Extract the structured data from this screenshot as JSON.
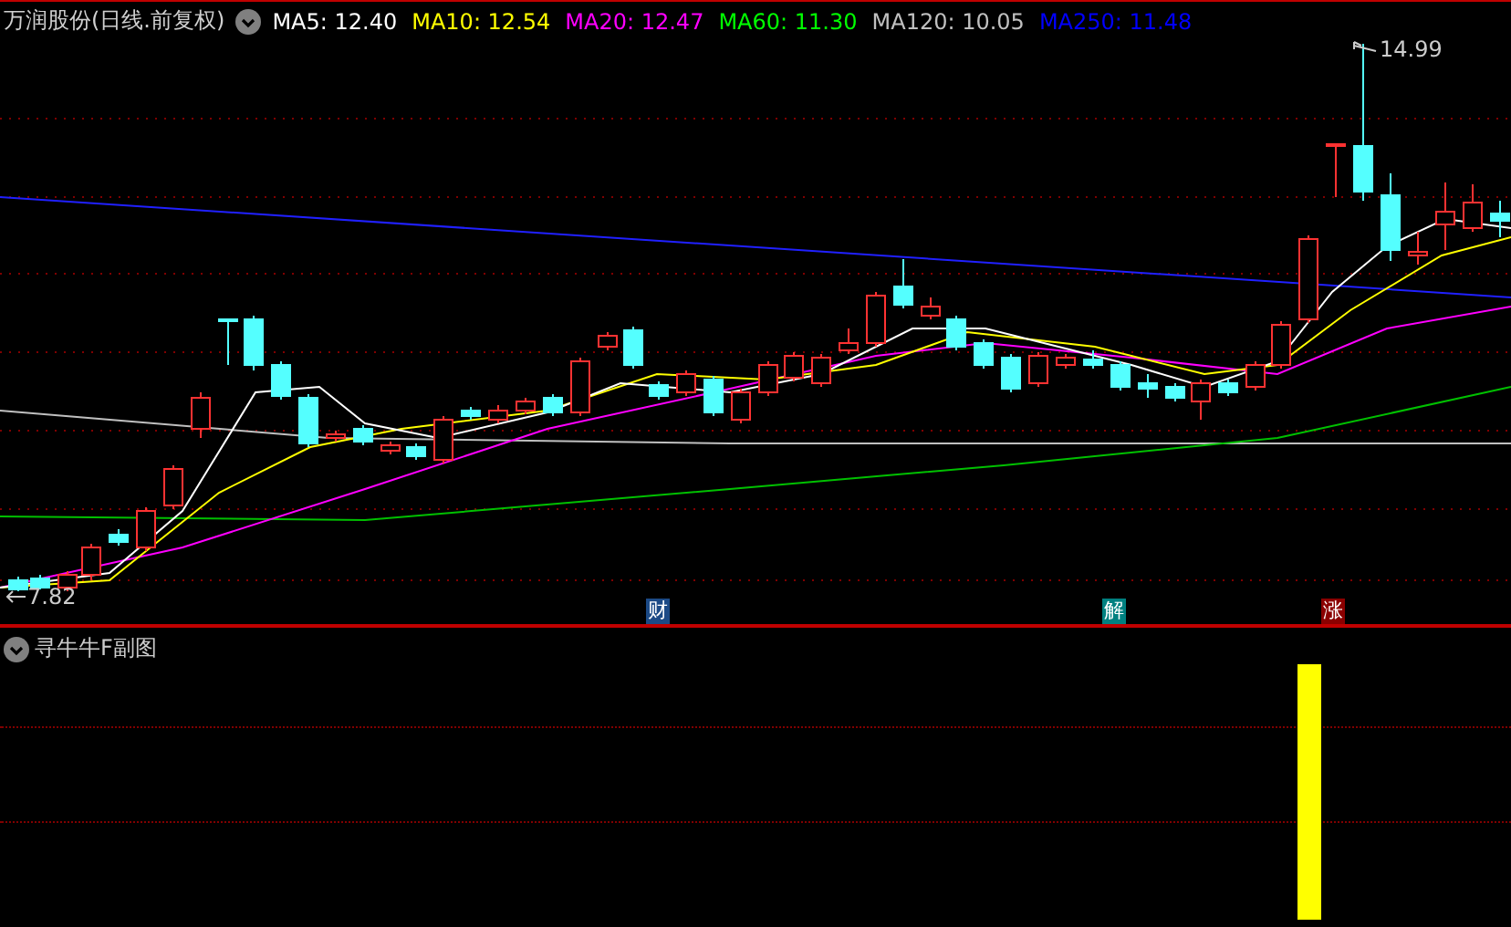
{
  "chart_header": {
    "title": "万润股份(日线.前复权)",
    "indicators": [
      {
        "label": "MA5: 12.40",
        "color": "#ffffff"
      },
      {
        "label": "MA10: 12.54",
        "color": "#ffff00"
      },
      {
        "label": "MA20: 12.47",
        "color": "#ff00ff"
      },
      {
        "label": "MA60: 11.30",
        "color": "#00ff00"
      },
      {
        "label": "MA120: 10.05",
        "color": "#c0c0c0"
      },
      {
        "label": "MA250: 11.48",
        "color": "#0000ff"
      }
    ]
  },
  "price_chart": {
    "high_label": "14.99",
    "low_label": "7.82",
    "markers": [
      {
        "label": "财",
        "color": "#1c4a86"
      },
      {
        "label": "解",
        "color": "#008080"
      },
      {
        "label": "涨",
        "color": "#8b0000"
      }
    ]
  },
  "sub_chart": {
    "title": "寻牛牛F副图"
  }
}
